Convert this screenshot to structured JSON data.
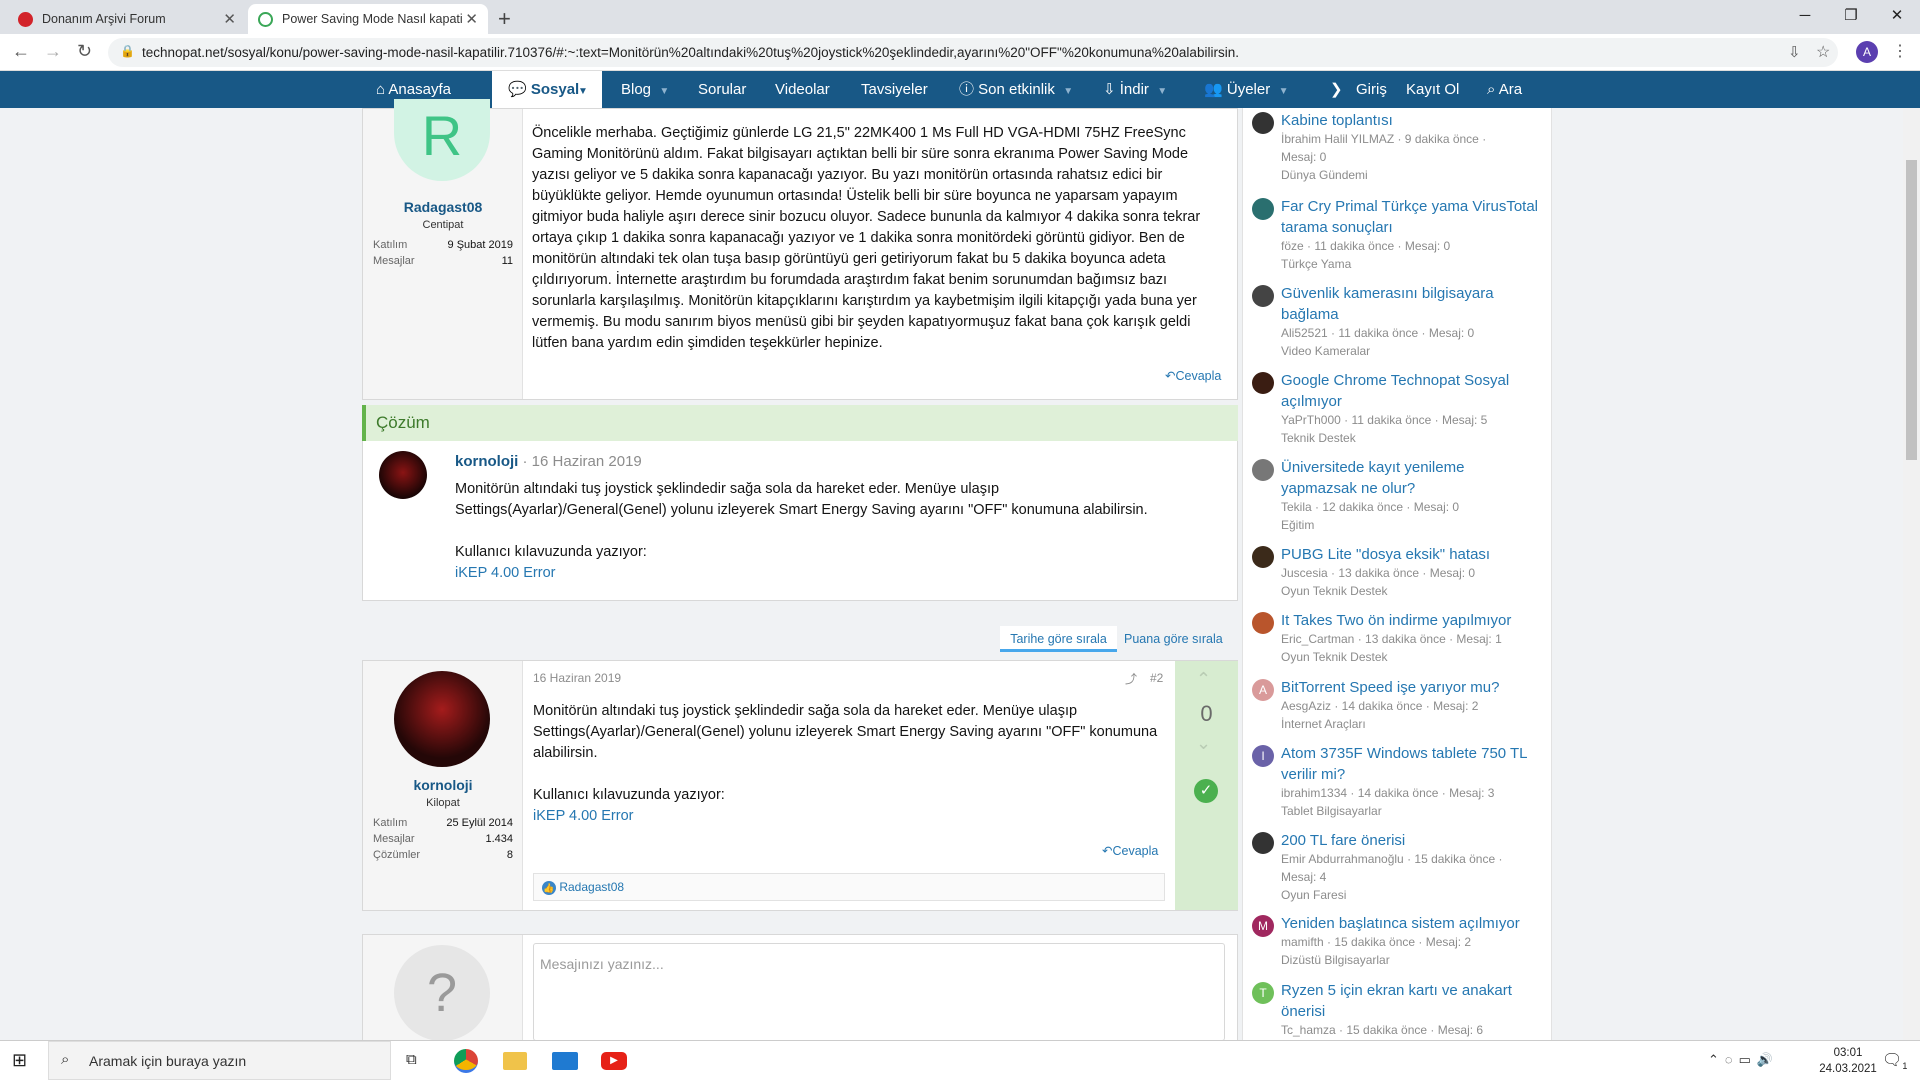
{
  "browser": {
    "tabs": [
      {
        "title": "Donanım Arşivi Forum"
      },
      {
        "title": "Power Saving Mode Nasıl kapati",
        "active": true
      }
    ],
    "new_tab": "+",
    "url": "technopat.net/sosyal/konu/power-saving-mode-nasil-kapatilir.710376/#:~:text=Monitörün%20altındaki%20tuş%20joystick%20şeklindedir,ayarını%20\"OFF\"%20konumuna%20alabilirsin.",
    "profile_initial": "A"
  },
  "nav": {
    "items": [
      "Anasayfa",
      "Sosyal",
      "Blog",
      "Sorular",
      "Videolar",
      "Tavsiyeler",
      "Son etkinlik",
      "İndir",
      "Üyeler"
    ],
    "login": "Giriş",
    "register": "Kayıt Ol",
    "search": "Ara"
  },
  "post1": {
    "avatar_letter": "R",
    "user": "Radagast08",
    "rank": "Centipat",
    "stats": [
      {
        "label": "Katılım",
        "value": "9 Şubat 2019"
      },
      {
        "label": "Mesajlar",
        "value": "11"
      }
    ],
    "lines": [
      "Öncelikle merhaba. Geçtiğimiz günlerde LG 21,5\" 22MK400 1 Ms Full HD VGA-HDMI 75HZ FreeSync",
      "Gaming Monitörünü aldım. Fakat bilgisayarı açtıktan belli bir süre sonra ekranıma Power Saving Mode",
      "yazısı geliyor ve 5 dakika sonra kapanacağı yazıyor. Bu yazı monitörün ortasında rahatsız edici bir",
      "büyüklükte geliyor. Hemde oyunumun ortasında! Üstelik belli bir süre boyunca ne yaparsam yapayım",
      "gitmiyor buda haliyle aşırı derece sinir bozucu oluyor. Sadece bununla da kalmıyor 4 dakika sonra tekrar",
      "ortaya çıkıp 1 dakika sonra kapanacağı yazıyor ve 1 dakika sonra monitördeki görüntü gidiyor. Ben de",
      "monitörün altındaki tek olan tuşa basıp görüntüyü geri getiriyorum fakat bu 5 dakika boyunca adeta",
      "çıldırıyorum. İnternette araştırdım bu forumdada araştırdım fakat benim sorunumdan bağımsız bazı",
      "sorunlarla karşılaşılmış. Monitörün kitapçıklarını karıştırdım ya kaybetmişim ilgili kitapçığı yada buna yer",
      "vermemiş. Bu modu sanırım biyos menüsü gibi bir şeyden kapatıyormuşuz fakat bana çok karışık geldi",
      "lütfen bana yardım edin şimdiden teşekkürler hepinize."
    ],
    "reply": "Cevapla"
  },
  "solution": {
    "heading": "Çözüm",
    "user": "kornoloji",
    "date": "· 16 Haziran 2019",
    "lines": [
      "Monitörün altındaki tuş joystick şeklindedir sağa sola da hareket eder. Menüye ulaşıp",
      "Settings(Ayarlar)/General(Genel) yolunu izleyerek Smart Energy Saving ayarını \"OFF\" konumuna alabilirsin."
    ],
    "guide": "Kullanıcı kılavuzunda yazıyor:",
    "link": "iKEP 4.00 Error"
  },
  "sort": {
    "by_date": "Tarihe göre sırala",
    "by_score": "Puana göre sırala"
  },
  "post2": {
    "user": "kornoloji",
    "rank": "Kilopat",
    "date": "16 Haziran 2019",
    "number": "#2",
    "stats": [
      {
        "label": "Katılım",
        "value": "25 Eylül 2014"
      },
      {
        "label": "Mesajlar",
        "value": "1.434"
      },
      {
        "label": "Çözümler",
        "value": "8"
      }
    ],
    "lines": [
      "Monitörün altındaki tuş joystick şeklindedir sağa sola da hareket eder. Menüye ulaşıp",
      "Settings(Ayarlar)/General(Genel) yolunu izleyerek Smart Energy Saving ayarını \"OFF\" konumuna",
      "alabilirsin."
    ],
    "guide": "Kullanıcı kılavuzunda yazıyor:",
    "link": "iKEP 4.00 Error",
    "reply": "Cevapla",
    "score": "0",
    "reaction_user": "Radagast08"
  },
  "composer": {
    "avatar": "?",
    "placeholder": "Mesajınızı yazınız..."
  },
  "sidebar": [
    {
      "title": "Kabine toplantısı",
      "meta": "İbrahim Halil YILMAZ · 9 dakika önce ·",
      "meta2": "Mesaj: 0",
      "forum": "Dünya Gündemi",
      "av": "",
      "color": "#333"
    },
    {
      "title": "Far Cry Primal Türkçe yama VirusTotal tarama sonuçları",
      "meta": "föze · 11 dakika önce · Mesaj: 0",
      "meta2": "",
      "forum": "Türkçe Yama",
      "av": "",
      "color": "#2a6f6f"
    },
    {
      "title": "Güvenlik kamerasını bilgisayara bağlama",
      "meta": "Ali52521 · 11 dakika önce · Mesaj: 0",
      "meta2": "",
      "forum": "Video Kameralar",
      "av": "",
      "color": "#444"
    },
    {
      "title": "Google Chrome Technopat Sosyal açılmıyor",
      "meta": "YaPrTh000 · 11 dakika önce · Mesaj: 5",
      "meta2": "",
      "forum": "Teknik Destek",
      "av": "",
      "color": "#3a1d12"
    },
    {
      "title": "Üniversitede kayıt yenileme yapmazsak ne olur?",
      "meta": "Tekila · 12 dakika önce · Mesaj: 0",
      "meta2": "",
      "forum": "Eğitim",
      "av": "",
      "color": "#777"
    },
    {
      "title": "PUBG Lite \"dosya eksik\" hatası",
      "meta": "Juscesia · 13 dakika önce · Mesaj: 0",
      "meta2": "",
      "forum": "Oyun Teknik Destek",
      "av": "",
      "color": "#3b2a1a"
    },
    {
      "title": "It Takes Two ön indirme yapılmıyor",
      "meta": "Eric_Cartman · 13 dakika önce · Mesaj: 1",
      "meta2": "",
      "forum": "Oyun Teknik Destek",
      "av": "",
      "color": "#b9552c"
    },
    {
      "title": "BitTorrent Speed işe yarıyor mu?",
      "meta": "AesgAziz · 14 dakika önce · Mesaj: 2",
      "meta2": "",
      "forum": "İnternet Araçları",
      "av": "A",
      "color": "#d99a9a"
    },
    {
      "title": "Atom 3735F Windows tablete 750 TL verilir mi?",
      "meta": "ibrahim1334 · 14 dakika önce · Mesaj: 3",
      "meta2": "",
      "forum": "Tablet Bilgisayarlar",
      "av": "I",
      "color": "#6a62a8"
    },
    {
      "title": "200 TL fare önerisi",
      "meta": "Emir Abdurrahmanoğlu · 15 dakika önce ·",
      "meta2": "Mesaj: 4",
      "forum": "Oyun Faresi",
      "av": "",
      "color": "#333"
    },
    {
      "title": "Yeniden başlatınca sistem açılmıyor",
      "meta": "mamifth · 15 dakika önce · Mesaj: 2",
      "meta2": "",
      "forum": "Dizüstü Bilgisayarlar",
      "av": "M",
      "color": "#a0285f"
    },
    {
      "title": "Ryzen 5 için ekran kartı ve anakart önerisi",
      "meta": "Tc_hamza · 15 dakika önce · Mesaj: 6",
      "meta2": "",
      "forum": "",
      "av": "T",
      "color": "#6fc05a"
    }
  ],
  "taskbar": {
    "search": "Aramak için buraya yazın",
    "time": "03:01",
    "date": "24.03.2021",
    "notif": "1"
  }
}
